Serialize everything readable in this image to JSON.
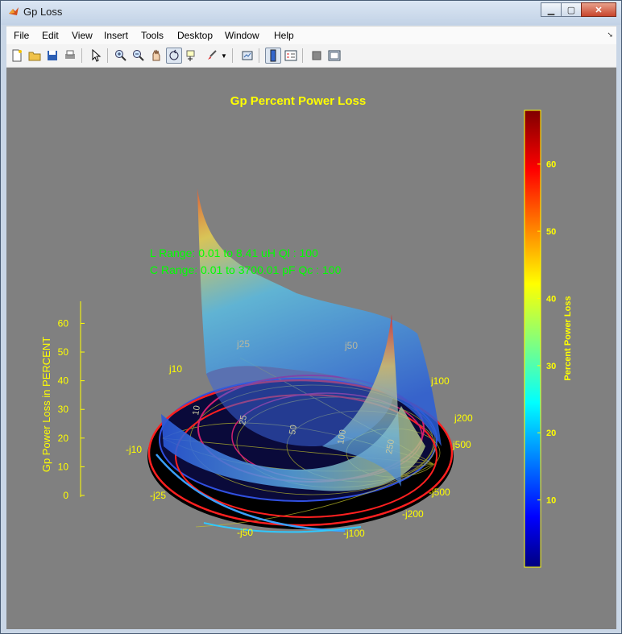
{
  "window": {
    "title": "Gp Loss"
  },
  "menu": [
    "File",
    "Edit",
    "View",
    "Insert",
    "Tools",
    "Desktop",
    "Window",
    "Help"
  ],
  "toolbar_icons": [
    "new-figure-icon",
    "open-file-icon",
    "save-icon",
    "print-icon",
    "pointer-icon",
    "zoom-in-icon",
    "zoom-out-icon",
    "pan-icon",
    "rotate-3d-icon",
    "data-cursor-icon",
    "brush-icon",
    "brush-dropdown-icon",
    "link-plot-icon",
    "colorbar-toggle-icon",
    "legend-toggle-icon",
    "hide-plot-tools-icon",
    "show-plot-tools-icon"
  ],
  "plot": {
    "title": "Gp Percent Power Loss",
    "annotation_l": "L  Range: 0.01 to 8.41 uH  Ql : 100",
    "annotation_c": "C Range: 0.01 to 3700.01 pF  Qc : 100",
    "zlabel": "Gp Power Loss in PERCENT",
    "z_ticks": [
      "0",
      "10",
      "20",
      "30",
      "40",
      "50",
      "60"
    ],
    "colorbar_label": "Percent Power Loss",
    "colorbar_ticks": [
      "10",
      "20",
      "30",
      "40",
      "50",
      "60"
    ],
    "smith_labels_outer": [
      "j10",
      "j25",
      "j50",
      "j100",
      "j200",
      "j500",
      "-j10",
      "-j25",
      "-j50",
      "-j100",
      "-j200",
      "-j500"
    ],
    "smith_labels_inner": [
      "10",
      "25",
      "50",
      "100",
      "250"
    ]
  },
  "colors": {
    "title": "#ffff00",
    "annotation": "#00ff00",
    "axis": "#ffff00",
    "figure_bg": "#808080"
  },
  "chart_data": {
    "type": "surface",
    "title": "Gp Percent Power Loss",
    "zlabel": "Gp Power Loss in PERCENT",
    "zlim": [
      0,
      68
    ],
    "colorbar": {
      "label": "Percent Power Loss",
      "range": [
        0,
        68
      ],
      "ticks": [
        10,
        20,
        30,
        40,
        50,
        60
      ]
    }
  }
}
